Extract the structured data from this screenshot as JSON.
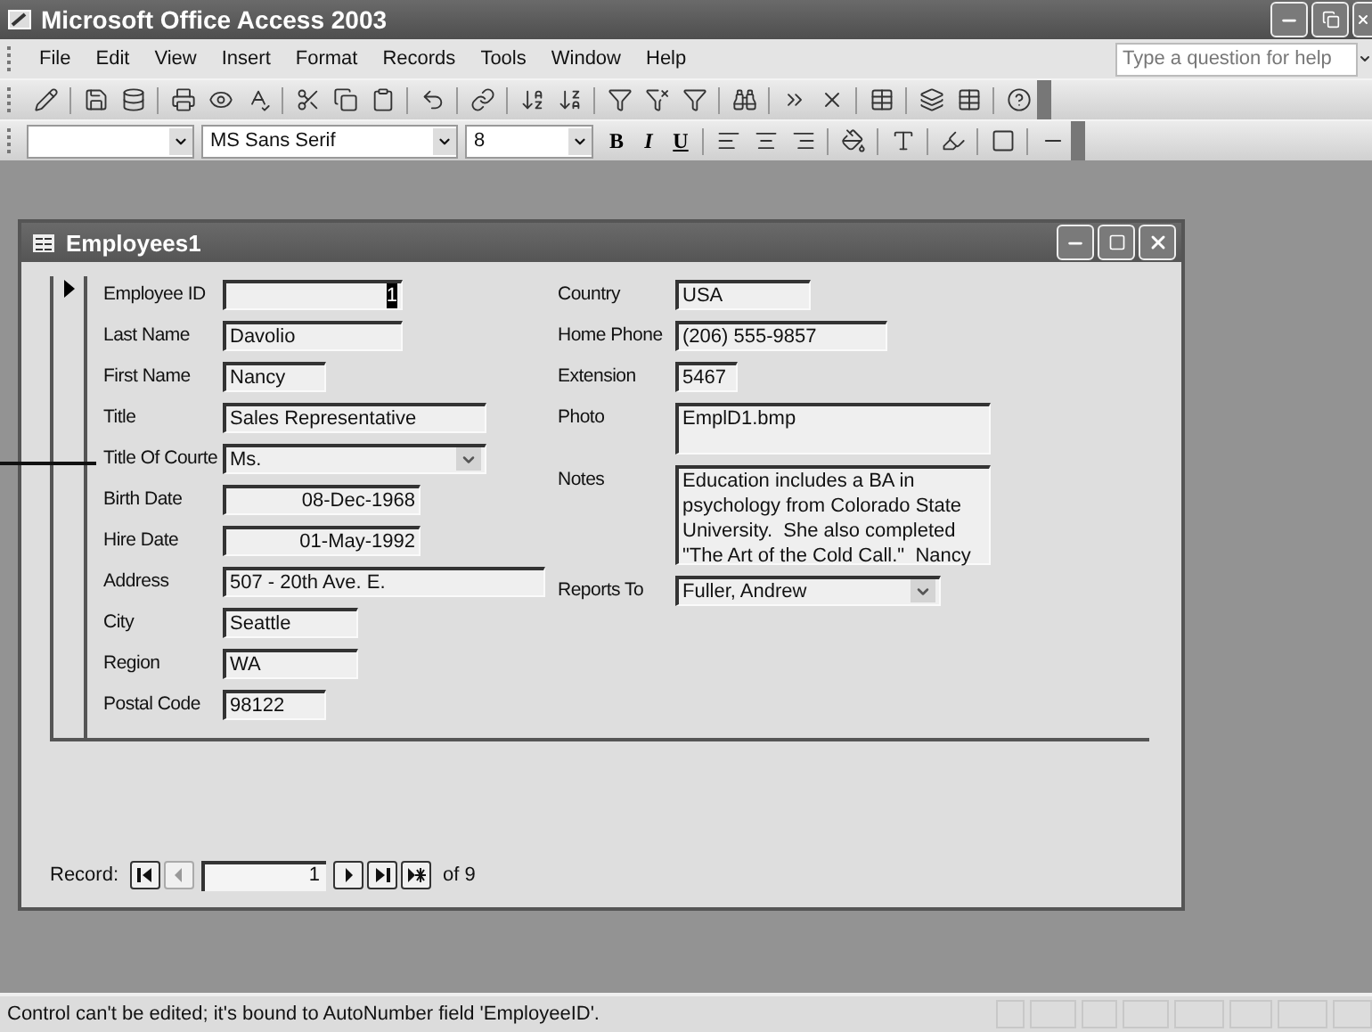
{
  "app_window": {
    "title": "Microsoft Office Access 2003"
  },
  "menu": [
    "File",
    "Edit",
    "View",
    "Insert",
    "Format",
    "Records",
    "Tools",
    "Window",
    "Help"
  ],
  "help_box": {
    "placeholder": "Type a question for help"
  },
  "formatting_toolbar": {
    "font": "MS Sans Serif",
    "size": "8",
    "style_buttons": [
      "B",
      "I",
      "U"
    ]
  },
  "form_window": {
    "title": "Employees1",
    "left_fields": [
      {
        "label": "Employee ID",
        "value": "1",
        "kind": "number",
        "highlighted": true
      },
      {
        "label": "Last Name",
        "value": "Davolio",
        "kind": "text",
        "highlighted": false
      },
      {
        "label": "First Name",
        "value": "Nancy",
        "kind": "text",
        "highlighted": false
      },
      {
        "label": "Title",
        "value": "Sales Representative",
        "kind": "text",
        "highlighted": false
      },
      {
        "label": "Title Of Courte",
        "value": "Ms.",
        "kind": "combo",
        "highlighted": false
      },
      {
        "label": "Birth Date",
        "value": "08-Dec-1968",
        "kind": "number",
        "highlighted": false
      },
      {
        "label": "Hire Date",
        "value": "01-May-1992",
        "kind": "number",
        "highlighted": false
      },
      {
        "label": "Address",
        "value": "507 - 20th Ave. E.",
        "kind": "text",
        "highlighted": false
      },
      {
        "label": "City",
        "value": "Seattle",
        "kind": "text",
        "highlighted": false
      },
      {
        "label": "Region",
        "value": "WA",
        "kind": "text",
        "highlighted": false
      },
      {
        "label": "Postal Code",
        "value": "98122",
        "kind": "text",
        "highlighted": false
      }
    ],
    "right_fields": [
      {
        "label": "Country",
        "value": "USA",
        "kind": "text",
        "highlighted": false
      },
      {
        "label": "Home Phone",
        "value": "(206) 555-9857",
        "kind": "text",
        "highlighted": false
      },
      {
        "label": "Extension",
        "value": "5467",
        "kind": "text",
        "highlighted": false
      },
      {
        "label": "Photo",
        "value": "EmplD1.bmp",
        "kind": "tall",
        "highlighted": false
      },
      {
        "label": "Notes",
        "value": "Education includes a BA in psychology from Colorado State University.  She also completed \"The Art of the Cold Call.\"  Nancy",
        "kind": "memo",
        "highlighted": false
      },
      {
        "label": "Reports To",
        "value": "Fuller, Andrew",
        "kind": "combo",
        "highlighted": false
      }
    ],
    "navigation": {
      "label": "Record:",
      "current": "1",
      "total": "of 9",
      "buttons": [
        {
          "kind": "first",
          "disabled": false
        },
        {
          "kind": "prev",
          "disabled": true
        }
      ],
      "buttons_after": [
        {
          "kind": "next",
          "disabled": false
        },
        {
          "kind": "last",
          "disabled": false
        },
        {
          "kind": "new",
          "disabled": false
        }
      ]
    }
  },
  "status_bar": {
    "message": "Control can't be edited; it's bound to AutoNumber field 'EmployeeID'."
  }
}
